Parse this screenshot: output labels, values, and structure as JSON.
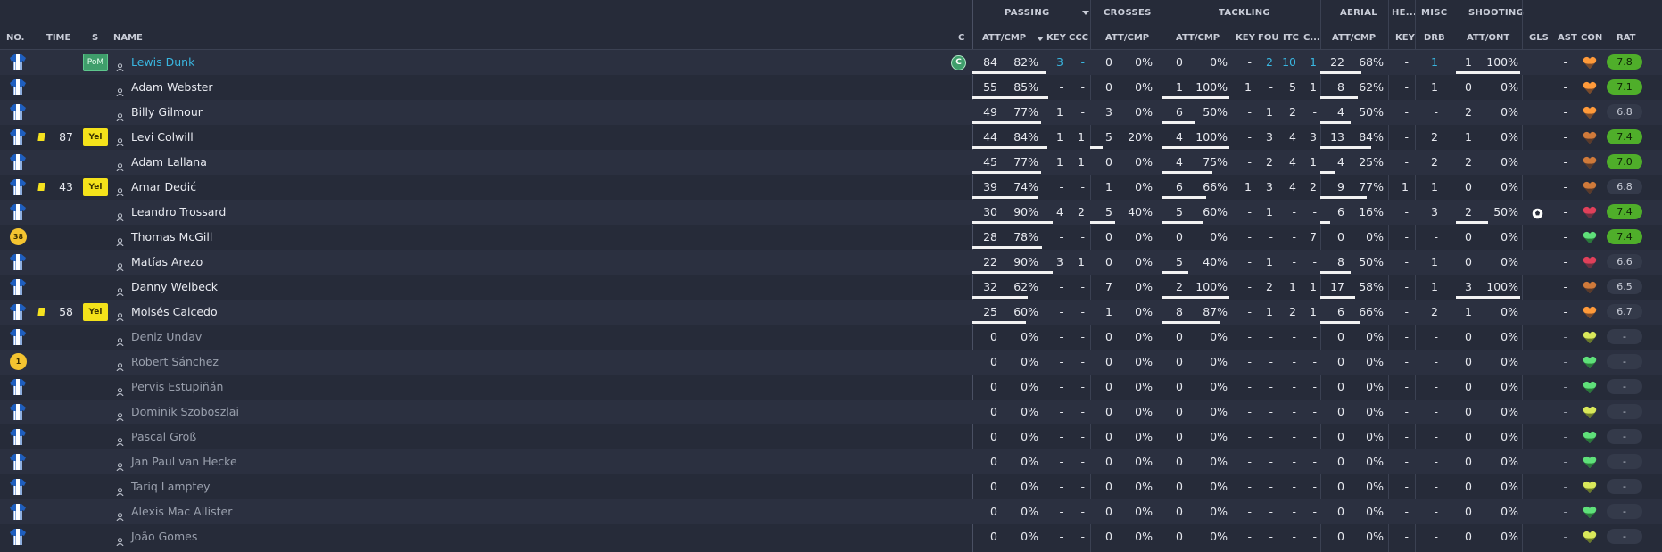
{
  "groups": {
    "passing": "PASSING",
    "crosses": "CROSSES",
    "tackling": "TACKLING",
    "aerial": "AERIAL",
    "headers": "HE...",
    "misc": "MISC",
    "shooting": "SHOOTING"
  },
  "columns": {
    "no": "NO.",
    "time": "TIME",
    "s": "S",
    "name": "NAME",
    "c": "C",
    "pass_attcmp": "ATT/CMP",
    "key": "KEY",
    "ccc": "CCC",
    "cross_attcmp": "ATT/CMP",
    "tack_attcmp": "ATT/CMP",
    "tkey": "KEY",
    "fou": "FOU",
    "itc": "ITC",
    "c2": "C...",
    "aer_attcmp": "ATT/CMP",
    "hkey": "KEY",
    "drb": "DRB",
    "shot_attont": "ATT/ONT",
    "gls": "GLS",
    "ast": "AST",
    "con": "CON",
    "rat": "RAT"
  },
  "colors": {
    "background": "#262b39",
    "row_alt": "#2b3040",
    "accent_cyan": "#39b6e0",
    "yellow_card": "#f5e21f",
    "pom_green": "#3f9e6b",
    "rating_green": "#4fae2a"
  },
  "players": [
    {
      "name": "Lewis Dunk",
      "kit": "shirt",
      "time": "",
      "card": false,
      "status": "PoM",
      "captain": "C",
      "highlight": true,
      "pass": [
        "84",
        "82%"
      ],
      "pass_fill": 0.82,
      "key": "3",
      "ccc": "-",
      "cross": [
        "0",
        "0%"
      ],
      "cross_fill": 0,
      "tack": [
        "0",
        "0%"
      ],
      "tack_fill": 0,
      "tkey": "-",
      "fou": "2",
      "itc": "10",
      "c2": "1",
      "aer": [
        "22",
        "68%"
      ],
      "aer_fill": 0.68,
      "hkey": "-",
      "drb": "1",
      "shot": [
        "1",
        "100%"
      ],
      "shot_fill": 1.0,
      "gls": "",
      "ast": "-",
      "con": "orange",
      "rating": "7.8",
      "rating_good": true
    },
    {
      "name": "Adam Webster",
      "kit": "shirt",
      "time": "",
      "card": false,
      "status": "",
      "pass": [
        "55",
        "85%"
      ],
      "pass_fill": 0.85,
      "key": "-",
      "ccc": "-",
      "cross": [
        "0",
        "0%"
      ],
      "cross_fill": 0,
      "tack": [
        "1",
        "100%"
      ],
      "tack_fill": 1.0,
      "tkey": "1",
      "fou": "-",
      "itc": "5",
      "c2": "1",
      "aer": [
        "8",
        "62%"
      ],
      "aer_fill": 0.62,
      "hkey": "-",
      "drb": "1",
      "shot": [
        "0",
        "0%"
      ],
      "shot_fill": 0,
      "gls": "",
      "ast": "-",
      "con": "orange",
      "rating": "7.1",
      "rating_good": true
    },
    {
      "name": "Billy Gilmour",
      "kit": "shirt",
      "time": "",
      "card": false,
      "status": "",
      "pass": [
        "49",
        "77%"
      ],
      "pass_fill": 0.77,
      "key": "1",
      "ccc": "-",
      "cross": [
        "3",
        "0%"
      ],
      "cross_fill": 0,
      "tack": [
        "6",
        "50%"
      ],
      "tack_fill": 0.5,
      "tkey": "-",
      "fou": "1",
      "itc": "2",
      "c2": "-",
      "aer": [
        "4",
        "50%"
      ],
      "aer_fill": 0.5,
      "hkey": "-",
      "drb": "-",
      "shot": [
        "2",
        "0%"
      ],
      "shot_fill": 0,
      "gls": "",
      "ast": "-",
      "con": "orange",
      "rating": "6.8",
      "rating_good": false
    },
    {
      "name": "Levi Colwill",
      "kit": "shirt",
      "time": "87",
      "card": true,
      "status": "Yel",
      "pass": [
        "44",
        "84%"
      ],
      "pass_fill": 0.84,
      "key": "1",
      "ccc": "1",
      "cross": [
        "5",
        "20%"
      ],
      "cross_fill": 0.2,
      "tack": [
        "4",
        "100%"
      ],
      "tack_fill": 1.0,
      "tkey": "-",
      "fou": "3",
      "itc": "4",
      "c2": "3",
      "aer": [
        "13",
        "84%"
      ],
      "aer_fill": 0.84,
      "hkey": "-",
      "drb": "2",
      "shot": [
        "1",
        "0%"
      ],
      "shot_fill": 0,
      "gls": "",
      "ast": "-",
      "con": "brown",
      "rating": "7.4",
      "rating_good": true
    },
    {
      "name": "Adam Lallana",
      "kit": "shirt",
      "time": "",
      "card": false,
      "status": "",
      "pass": [
        "45",
        "77%"
      ],
      "pass_fill": 0.77,
      "key": "1",
      "ccc": "1",
      "cross": [
        "0",
        "0%"
      ],
      "cross_fill": 0,
      "tack": [
        "4",
        "75%"
      ],
      "tack_fill": 0.75,
      "tkey": "-",
      "fou": "2",
      "itc": "4",
      "c2": "1",
      "aer": [
        "4",
        "25%"
      ],
      "aer_fill": 0.25,
      "hkey": "-",
      "drb": "2",
      "shot": [
        "2",
        "0%"
      ],
      "shot_fill": 0,
      "gls": "",
      "ast": "-",
      "con": "brown",
      "rating": "7.0",
      "rating_good": true
    },
    {
      "name": "Amar Dedić",
      "kit": "shirt",
      "time": "43",
      "card": true,
      "status": "Yel",
      "pass": [
        "39",
        "74%"
      ],
      "pass_fill": 0.74,
      "key": "-",
      "ccc": "-",
      "cross": [
        "1",
        "0%"
      ],
      "cross_fill": 0,
      "tack": [
        "6",
        "66%"
      ],
      "tack_fill": 0.66,
      "tkey": "1",
      "fou": "3",
      "itc": "4",
      "c2": "2",
      "aer": [
        "9",
        "77%"
      ],
      "aer_fill": 0.77,
      "hkey": "1",
      "drb": "1",
      "shot": [
        "0",
        "0%"
      ],
      "shot_fill": 0,
      "gls": "",
      "ast": "-",
      "con": "brown",
      "rating": "6.8",
      "rating_good": false
    },
    {
      "name": "Leandro Trossard",
      "kit": "shirt",
      "time": "",
      "card": false,
      "status": "",
      "pass": [
        "30",
        "90%"
      ],
      "pass_fill": 0.9,
      "key": "4",
      "ccc": "2",
      "cross": [
        "5",
        "40%"
      ],
      "cross_fill": 0.4,
      "tack": [
        "5",
        "60%"
      ],
      "tack_fill": 0.6,
      "tkey": "-",
      "fou": "1",
      "itc": "-",
      "c2": "-",
      "aer": [
        "6",
        "16%"
      ],
      "aer_fill": 0.16,
      "hkey": "-",
      "drb": "3",
      "shot": [
        "2",
        "50%"
      ],
      "shot_fill": 0.5,
      "gls": "ball",
      "ast": "-",
      "con": "red",
      "rating": "7.4",
      "rating_good": true
    },
    {
      "name": "Thomas McGill",
      "kit": "gk",
      "kit_no": "38",
      "time": "",
      "card": false,
      "status": "",
      "pass": [
        "28",
        "78%"
      ],
      "pass_fill": 0.78,
      "key": "-",
      "ccc": "-",
      "cross": [
        "0",
        "0%"
      ],
      "cross_fill": 0,
      "tack": [
        "0",
        "0%"
      ],
      "tack_fill": 0,
      "tkey": "-",
      "fou": "-",
      "itc": "-",
      "c2": "7",
      "aer": [
        "0",
        "0%"
      ],
      "aer_fill": 0,
      "hkey": "-",
      "drb": "-",
      "shot": [
        "0",
        "0%"
      ],
      "shot_fill": 0,
      "gls": "",
      "ast": "-",
      "con": "green",
      "rating": "7.4",
      "rating_good": true
    },
    {
      "name": "Matías Arezo",
      "kit": "shirt",
      "time": "",
      "card": false,
      "status": "",
      "pass": [
        "22",
        "90%"
      ],
      "pass_fill": 0.9,
      "key": "3",
      "ccc": "1",
      "cross": [
        "0",
        "0%"
      ],
      "cross_fill": 0,
      "tack": [
        "5",
        "40%"
      ],
      "tack_fill": 0.4,
      "tkey": "-",
      "fou": "1",
      "itc": "-",
      "c2": "-",
      "aer": [
        "8",
        "50%"
      ],
      "aer_fill": 0.5,
      "hkey": "-",
      "drb": "1",
      "shot": [
        "0",
        "0%"
      ],
      "shot_fill": 0,
      "gls": "",
      "ast": "-",
      "con": "red",
      "rating": "6.6",
      "rating_good": false
    },
    {
      "name": "Danny Welbeck",
      "kit": "shirt",
      "time": "",
      "card": false,
      "status": "",
      "pass": [
        "32",
        "62%"
      ],
      "pass_fill": 0.62,
      "key": "-",
      "ccc": "-",
      "cross": [
        "7",
        "0%"
      ],
      "cross_fill": 0,
      "tack": [
        "2",
        "100%"
      ],
      "tack_fill": 1.0,
      "tkey": "-",
      "fou": "2",
      "itc": "1",
      "c2": "1",
      "aer": [
        "17",
        "58%"
      ],
      "aer_fill": 0.58,
      "hkey": "-",
      "drb": "1",
      "shot": [
        "3",
        "100%"
      ],
      "shot_fill": 1.0,
      "gls": "",
      "ast": "-",
      "con": "brown",
      "rating": "6.5",
      "rating_good": false
    },
    {
      "name": "Moisés Caicedo",
      "kit": "shirt",
      "time": "58",
      "card": true,
      "status": "Yel",
      "pass": [
        "25",
        "60%"
      ],
      "pass_fill": 0.6,
      "key": "-",
      "ccc": "-",
      "cross": [
        "1",
        "0%"
      ],
      "cross_fill": 0,
      "tack": [
        "8",
        "87%"
      ],
      "tack_fill": 0.87,
      "tkey": "-",
      "fou": "1",
      "itc": "2",
      "c2": "1",
      "aer": [
        "6",
        "66%"
      ],
      "aer_fill": 0.66,
      "hkey": "-",
      "drb": "2",
      "shot": [
        "1",
        "0%"
      ],
      "shot_fill": 0,
      "gls": "",
      "ast": "-",
      "con": "orange",
      "rating": "6.7",
      "rating_good": false
    },
    {
      "name": "Deniz Undav",
      "kit": "shirt",
      "sub": true,
      "time": "",
      "card": false,
      "status": "",
      "pass": [
        "0",
        "0%"
      ],
      "pass_fill": 0,
      "key": "-",
      "ccc": "-",
      "cross": [
        "0",
        "0%"
      ],
      "cross_fill": 0,
      "tack": [
        "0",
        "0%"
      ],
      "tack_fill": 0,
      "tkey": "-",
      "fou": "-",
      "itc": "-",
      "c2": "-",
      "aer": [
        "0",
        "0%"
      ],
      "aer_fill": 0,
      "hkey": "-",
      "drb": "-",
      "shot": [
        "0",
        "0%"
      ],
      "shot_fill": 0,
      "gls": "",
      "ast": "-",
      "con": "yellow",
      "rating": "-",
      "rating_good": false
    },
    {
      "name": "Robert Sánchez",
      "kit": "gk",
      "kit_no": "1",
      "sub": true,
      "time": "",
      "card": false,
      "status": "",
      "pass": [
        "0",
        "0%"
      ],
      "pass_fill": 0,
      "key": "-",
      "ccc": "-",
      "cross": [
        "0",
        "0%"
      ],
      "cross_fill": 0,
      "tack": [
        "0",
        "0%"
      ],
      "tack_fill": 0,
      "tkey": "-",
      "fou": "-",
      "itc": "-",
      "c2": "-",
      "aer": [
        "0",
        "0%"
      ],
      "aer_fill": 0,
      "hkey": "-",
      "drb": "-",
      "shot": [
        "0",
        "0%"
      ],
      "shot_fill": 0,
      "gls": "",
      "ast": "-",
      "con": "green",
      "rating": "-",
      "rating_good": false
    },
    {
      "name": "Pervis Estupiñán",
      "kit": "shirt",
      "sub": true,
      "time": "",
      "card": false,
      "status": "",
      "pass": [
        "0",
        "0%"
      ],
      "pass_fill": 0,
      "key": "-",
      "ccc": "-",
      "cross": [
        "0",
        "0%"
      ],
      "cross_fill": 0,
      "tack": [
        "0",
        "0%"
      ],
      "tack_fill": 0,
      "tkey": "-",
      "fou": "-",
      "itc": "-",
      "c2": "-",
      "aer": [
        "0",
        "0%"
      ],
      "aer_fill": 0,
      "hkey": "-",
      "drb": "-",
      "shot": [
        "0",
        "0%"
      ],
      "shot_fill": 0,
      "gls": "",
      "ast": "-",
      "con": "green",
      "rating": "-",
      "rating_good": false
    },
    {
      "name": "Dominik Szoboszlai",
      "kit": "shirt",
      "sub": true,
      "time": "",
      "card": false,
      "status": "",
      "pass": [
        "0",
        "0%"
      ],
      "pass_fill": 0,
      "key": "-",
      "ccc": "-",
      "cross": [
        "0",
        "0%"
      ],
      "cross_fill": 0,
      "tack": [
        "0",
        "0%"
      ],
      "tack_fill": 0,
      "tkey": "-",
      "fou": "-",
      "itc": "-",
      "c2": "-",
      "aer": [
        "0",
        "0%"
      ],
      "aer_fill": 0,
      "hkey": "-",
      "drb": "-",
      "shot": [
        "0",
        "0%"
      ],
      "shot_fill": 0,
      "gls": "",
      "ast": "-",
      "con": "yellow",
      "rating": "-",
      "rating_good": false
    },
    {
      "name": "Pascal Groß",
      "kit": "shirt",
      "sub": true,
      "time": "",
      "card": false,
      "status": "",
      "pass": [
        "0",
        "0%"
      ],
      "pass_fill": 0,
      "key": "-",
      "ccc": "-",
      "cross": [
        "0",
        "0%"
      ],
      "cross_fill": 0,
      "tack": [
        "0",
        "0%"
      ],
      "tack_fill": 0,
      "tkey": "-",
      "fou": "-",
      "itc": "-",
      "c2": "-",
      "aer": [
        "0",
        "0%"
      ],
      "aer_fill": 0,
      "hkey": "-",
      "drb": "-",
      "shot": [
        "0",
        "0%"
      ],
      "shot_fill": 0,
      "gls": "",
      "ast": "-",
      "con": "green",
      "rating": "-",
      "rating_good": false
    },
    {
      "name": "Jan Paul van Hecke",
      "kit": "shirt",
      "sub": true,
      "time": "",
      "card": false,
      "status": "",
      "pass": [
        "0",
        "0%"
      ],
      "pass_fill": 0,
      "key": "-",
      "ccc": "-",
      "cross": [
        "0",
        "0%"
      ],
      "cross_fill": 0,
      "tack": [
        "0",
        "0%"
      ],
      "tack_fill": 0,
      "tkey": "-",
      "fou": "-",
      "itc": "-",
      "c2": "-",
      "aer": [
        "0",
        "0%"
      ],
      "aer_fill": 0,
      "hkey": "-",
      "drb": "-",
      "shot": [
        "0",
        "0%"
      ],
      "shot_fill": 0,
      "gls": "",
      "ast": "-",
      "con": "green",
      "rating": "-",
      "rating_good": false
    },
    {
      "name": "Tariq Lamptey",
      "kit": "shirt",
      "sub": true,
      "time": "",
      "card": false,
      "status": "",
      "pass": [
        "0",
        "0%"
      ],
      "pass_fill": 0,
      "key": "-",
      "ccc": "-",
      "cross": [
        "0",
        "0%"
      ],
      "cross_fill": 0,
      "tack": [
        "0",
        "0%"
      ],
      "tack_fill": 0,
      "tkey": "-",
      "fou": "-",
      "itc": "-",
      "c2": "-",
      "aer": [
        "0",
        "0%"
      ],
      "aer_fill": 0,
      "hkey": "-",
      "drb": "-",
      "shot": [
        "0",
        "0%"
      ],
      "shot_fill": 0,
      "gls": "",
      "ast": "-",
      "con": "yellow",
      "rating": "-",
      "rating_good": false
    },
    {
      "name": "Alexis Mac Allister",
      "kit": "shirt",
      "sub": true,
      "time": "",
      "card": false,
      "status": "",
      "pass": [
        "0",
        "0%"
      ],
      "pass_fill": 0,
      "key": "-",
      "ccc": "-",
      "cross": [
        "0",
        "0%"
      ],
      "cross_fill": 0,
      "tack": [
        "0",
        "0%"
      ],
      "tack_fill": 0,
      "tkey": "-",
      "fou": "-",
      "itc": "-",
      "c2": "-",
      "aer": [
        "0",
        "0%"
      ],
      "aer_fill": 0,
      "hkey": "-",
      "drb": "-",
      "shot": [
        "0",
        "0%"
      ],
      "shot_fill": 0,
      "gls": "",
      "ast": "-",
      "con": "green",
      "rating": "-",
      "rating_good": false
    },
    {
      "name": "João Gomes",
      "kit": "shirt",
      "sub": true,
      "time": "",
      "card": false,
      "status": "",
      "pass": [
        "0",
        "0%"
      ],
      "pass_fill": 0,
      "key": "-",
      "ccc": "-",
      "cross": [
        "0",
        "0%"
      ],
      "cross_fill": 0,
      "tack": [
        "0",
        "0%"
      ],
      "tack_fill": 0,
      "tkey": "-",
      "fou": "-",
      "itc": "-",
      "c2": "-",
      "aer": [
        "0",
        "0%"
      ],
      "aer_fill": 0,
      "hkey": "-",
      "drb": "-",
      "shot": [
        "0",
        "0%"
      ],
      "shot_fill": 0,
      "gls": "",
      "ast": "-",
      "con": "yellow",
      "rating": "-",
      "rating_good": false
    }
  ]
}
